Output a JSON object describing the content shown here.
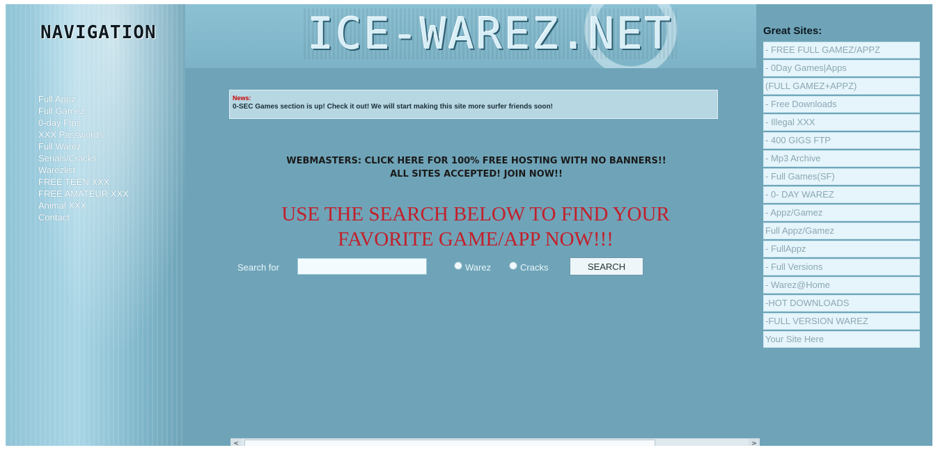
{
  "nav": {
    "title": "NAVIGATION",
    "links": [
      "Full Appz",
      "Full Gamez",
      "0-day Ftps",
      "XXX Passwords",
      "Full Warez",
      "Serials/Cracks",
      "Warezlist",
      "FREE TEEN XXX",
      "FREE AMATEUR XXX",
      "Animal XXX",
      "Contact"
    ]
  },
  "header": {
    "logo_text": "ICE-WAREZ.NET"
  },
  "news": {
    "label": "News:",
    "text": "0-SEC Games section is up! Check it out! We will start making this site more surfer friends soon!"
  },
  "promo": {
    "line1": "WEBMASTERS: CLICK HERE FOR 100% FREE HOSTING WITH NO BANNERS!!",
    "line2": "ALL SITES ACCEPTED! JOIN NOW!!"
  },
  "search": {
    "heading_line1": "USE THE SEARCH BELOW TO FIND YOUR",
    "heading_line2": "FAVORITE GAME/APP NOW!!!",
    "label": "Search for",
    "input_value": "",
    "options": [
      "Warez",
      "Cracks"
    ],
    "button_label": "SEARCH"
  },
  "great_sites": {
    "title": "Great Sites:",
    "items": [
      "- FREE FULL GAMEZ/APPZ",
      "- 0Day Games|Apps",
      "(FULL GAMEZ+APPZ)",
      "- Free Downloads",
      "- Illegal XXX",
      "- 400 GIGS FTP",
      "- Mp3 Archive",
      "- Full Games(SF)",
      "- 0- DAY WAREZ",
      "- Appz/Gamez",
      "Full Appz/Gamez",
      "- FullAppz",
      "- Full Versions",
      "- Warez@Home",
      "-HOT DOWNLOADS",
      "-FULL VERSION WAREZ",
      "Your Site Here"
    ]
  },
  "scrollbar": {
    "left_arrow": "<",
    "right_arrow": ">"
  }
}
